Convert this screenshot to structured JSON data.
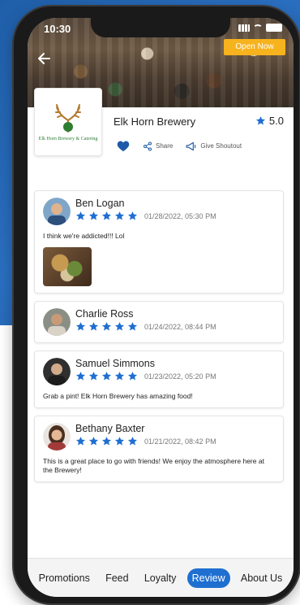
{
  "status_bar": {
    "time": "10:30"
  },
  "header": {
    "open_badge": "Open Now",
    "back_icon": "arrow-left-icon"
  },
  "business": {
    "name": "Elk Horn Brewery",
    "rating": "5.0",
    "logo_text": "Elk Horn Brewery & Catering",
    "actions": {
      "like_icon": "heart-icon",
      "share_label": "Share",
      "shoutout_label": "Give Shoutout"
    }
  },
  "reviews": [
    {
      "name": "Ben Logan",
      "stars": 5,
      "date": "01/28/2022, 05:30 PM",
      "text": "I think we're addicted!!! Lol",
      "has_photo": true
    },
    {
      "name": "Charlie Ross",
      "stars": 5,
      "date": "01/24/2022, 08:44 PM",
      "text": "",
      "has_photo": false
    },
    {
      "name": "Samuel Simmons",
      "stars": 5,
      "date": "01/23/2022, 05:20 PM",
      "text": "Grab a pint! Elk Horn Brewery has amazing food!",
      "has_photo": false
    },
    {
      "name": "Bethany Baxter",
      "stars": 5,
      "date": "01/21/2022, 08:42 PM",
      "text": "This is a great place to go with friends! We enjoy the atmosphere here at the Brewery!",
      "has_photo": false
    }
  ],
  "bottom_nav": {
    "items": [
      "Promotions",
      "Feed",
      "Loyalty",
      "Review",
      "About Us"
    ],
    "active": "Review"
  },
  "colors": {
    "accent": "#1f6fd1",
    "star": "#1f6fd1",
    "heart": "#1f5aa8",
    "open_badge": "#f7b31e"
  }
}
